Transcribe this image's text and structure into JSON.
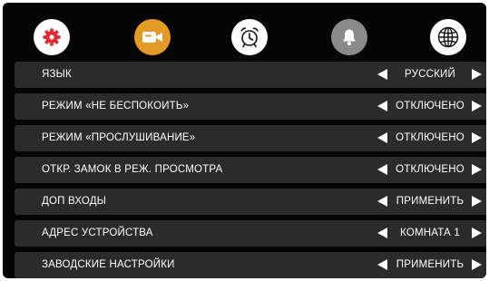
{
  "tabs": [
    {
      "icon": "gear-icon",
      "color": "#e8262d"
    },
    {
      "icon": "camera-icon",
      "color": "#e39a25"
    },
    {
      "icon": "alarm-clock-icon",
      "color": "#ffffff"
    },
    {
      "icon": "bell-icon",
      "color": "#8a8a8a"
    },
    {
      "icon": "globe-icon",
      "color": "#ffffff"
    }
  ],
  "menu": {
    "rows": [
      {
        "label": "ЯЗЫК",
        "value": "РУССКИЙ"
      },
      {
        "label": "РЕЖИМ «НЕ БЕСПОКОИТЬ»",
        "value": "ОТКЛЮЧЕНО"
      },
      {
        "label": "РЕЖИМ «ПРОСЛУШИВАНИЕ»",
        "value": "ОТКЛЮЧЕНО"
      },
      {
        "label": "ОТКР. ЗАМОК В РЕЖ. ПРОСМОТРА",
        "value": "ОТКЛЮЧЕНО"
      },
      {
        "label": "ДОП ВХОДЫ",
        "value": "ПРИМЕНИТЬ"
      },
      {
        "label": "АДРЕС УСТРОЙСТВА",
        "value": "КОМНАТА 1"
      },
      {
        "label": "ЗАВОДСКИЕ НАСТРОЙКИ",
        "value": "ПРИМЕНИТЬ"
      }
    ]
  }
}
